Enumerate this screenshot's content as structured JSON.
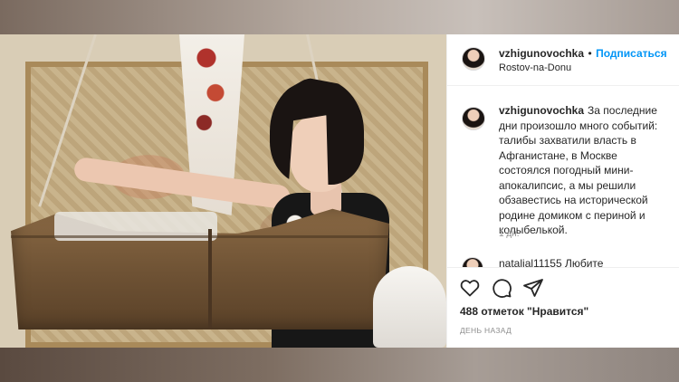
{
  "post": {
    "username": "vzhigunovochka",
    "separator": "•",
    "follow_label": "Подписаться",
    "location": "Rostov-na-Donu",
    "caption": "За последние дни произошло много событий: талибы захватили власть в Афганистане, в Москве состоялся погодный мини-апокалипсис, а мы решили обзавестись на исторической родине домиком с периной и колыбелькой.",
    "time_ago": "1 дн.",
    "comment_preview": "natalial11155  Любите",
    "likes": "488 отметок \"Нравится\"",
    "date_label": "ДЕНЬ НАЗАД"
  },
  "icons": [
    "heart-icon",
    "comment-icon",
    "share-icon"
  ],
  "colors": {
    "accent": "#0095f6",
    "text": "#262626",
    "muted": "#8e8e8e"
  }
}
